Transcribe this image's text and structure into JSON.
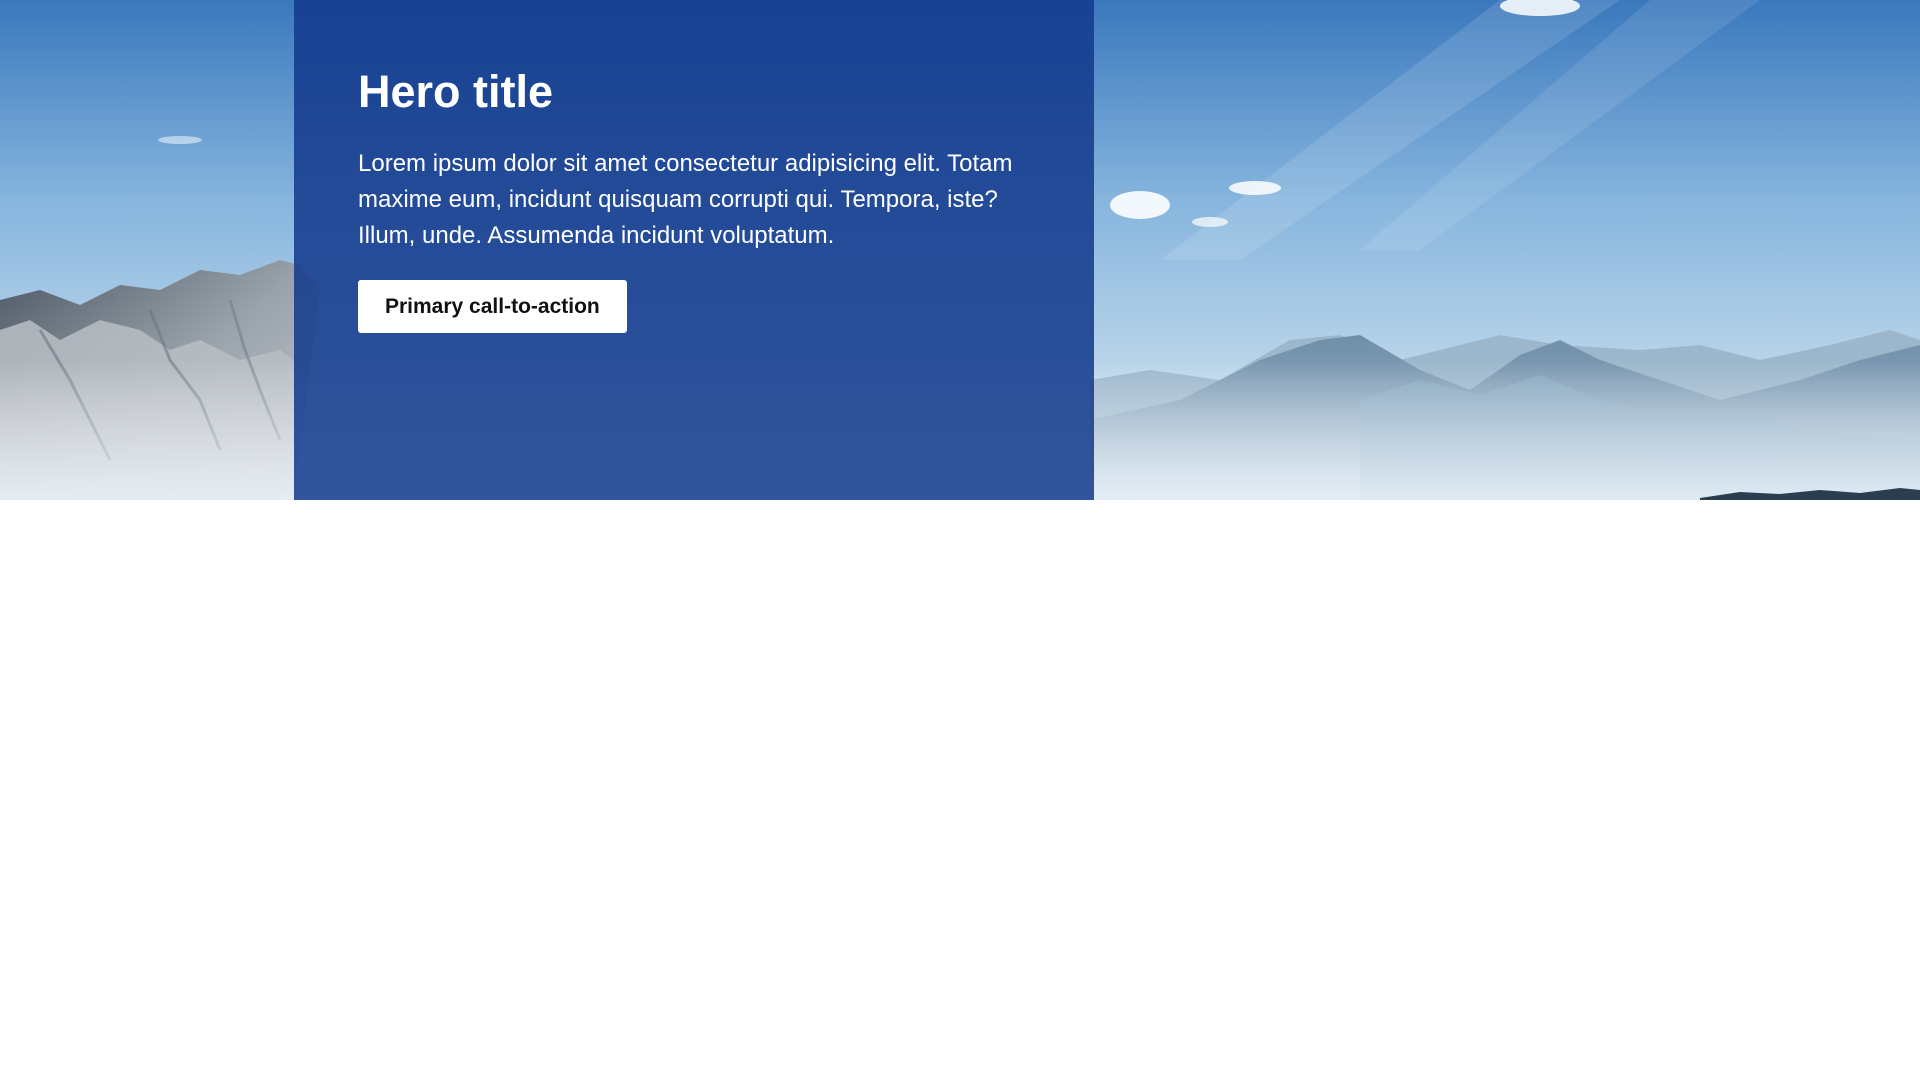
{
  "hero": {
    "title": "Hero title",
    "text": "Lorem ipsum dolor sit amet consectetur adipisicing elit. Totam maxime eum, incidunt quisquam corrupti qui. Tempora, iste? Illum, unde. Assumenda incidunt voluptatum.",
    "cta_label": "Primary call-to-action",
    "panel_color": "#13398c",
    "background_image": "mountain-landscape"
  }
}
